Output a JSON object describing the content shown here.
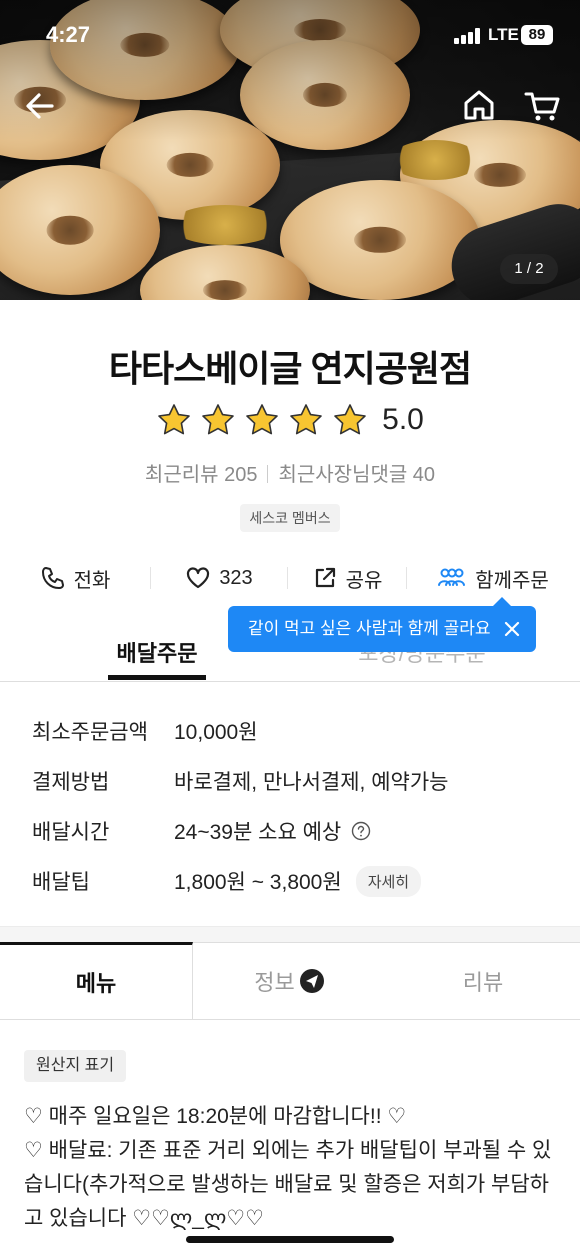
{
  "status_bar": {
    "time": "4:27",
    "network": "LTE",
    "battery": "89"
  },
  "hero": {
    "page_indicator": "1 / 2"
  },
  "store": {
    "name": "타타스베이글 연지공원점",
    "rating": "5.0",
    "stars": 5,
    "recent_reviews": "최근리뷰 205",
    "owner_replies": "최근사장님댓글 40",
    "member_badge": "세스코 멤버스"
  },
  "actions": {
    "call": "전화",
    "likes": "323",
    "share": "공유",
    "group_order": "함께주문"
  },
  "tooltip": {
    "text": "같이 먹고 싶은 사람과 함께 골라요"
  },
  "order_tabs": {
    "delivery": "배달주문",
    "pickup": "포장/방문주문"
  },
  "info": {
    "min_order_label": "최소주문금액",
    "min_order_value": "10,000원",
    "payment_label": "결제방법",
    "payment_value": "바로결제, 만나서결제, 예약가능",
    "delivery_time_label": "배달시간",
    "delivery_time_value": "24~39분 소요 예상",
    "delivery_tip_label": "배달팁",
    "delivery_tip_value": "1,800원 ~ 3,800원",
    "detail_button": "자세히"
  },
  "content_tabs": {
    "menu": "메뉴",
    "info": "정보",
    "review": "리뷰"
  },
  "origin_chip": "원산지 표기",
  "notice": {
    "line1": "♡ 매주 일요일은 18:20분에 마감합니다!! ♡",
    "line2": "♡ 배달료: 기존 표준 거리 외에는 추가 배달팁이 부과될 수 있습니다(추가적으로 발생하는 배달료 및 할증은 저희가 부담하고 있습니다 ♡♡ლ_ლ♡♡"
  },
  "colors": {
    "accent_blue": "#1e88f5",
    "star_yellow": "#f7c531"
  }
}
